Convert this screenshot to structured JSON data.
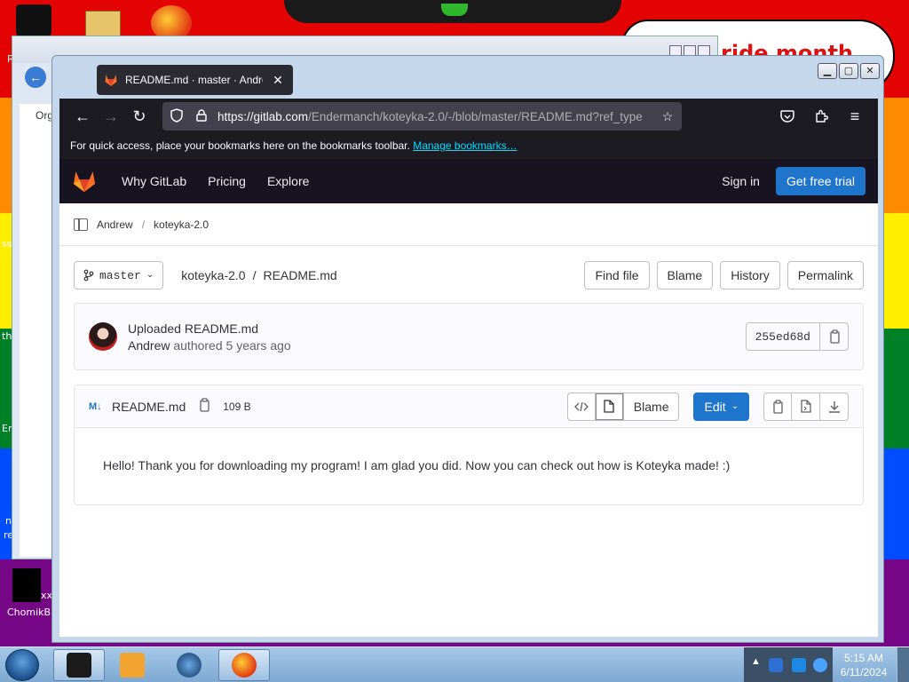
{
  "desktop": {
    "banner_text": "ride month",
    "icon_label": "ChomikB",
    "edge_texts": [
      "R",
      "Org",
      "ss",
      "th",
      "En",
      "n",
      "re",
      "xx"
    ]
  },
  "browser": {
    "tab_title": "README.md · master · Andrew",
    "url_host": "https://gitlab.com",
    "url_path": "/Endermanch/koteyka-2.0/-/blob/master/README.md?ref_type",
    "bookmarks_text": "For quick access, place your bookmarks here on the bookmarks toolbar.",
    "bookmarks_link": "Manage bookmarks…"
  },
  "gitlab_nav": {
    "links": [
      "Why GitLab",
      "Pricing",
      "Explore"
    ],
    "sign_in": "Sign in",
    "trial": "Get free trial",
    "brand_color": "#fc6d26"
  },
  "breadcrumb": [
    "Andrew",
    "koteyka-2.0"
  ],
  "repo": {
    "branch": "master",
    "path_project": "koteyka-2.0",
    "path_sep": "/",
    "path_file": "README.md",
    "buttons": [
      "Find file",
      "Blame",
      "History",
      "Permalink"
    ]
  },
  "commit": {
    "title": "Uploaded README.md",
    "author": "Andrew",
    "meta": "authored 5 years ago",
    "sha": "255ed68d"
  },
  "file": {
    "icon_text": "M↓",
    "name": "README.md",
    "size": "109 B",
    "blame": "Blame",
    "edit": "Edit",
    "content": "Hello! Thank you for downloading my program! I am glad you did. Now you can check out how is Koteyka made! :)"
  },
  "taskbar": {
    "time": "5:15 AM",
    "date": "6/11/2024"
  }
}
